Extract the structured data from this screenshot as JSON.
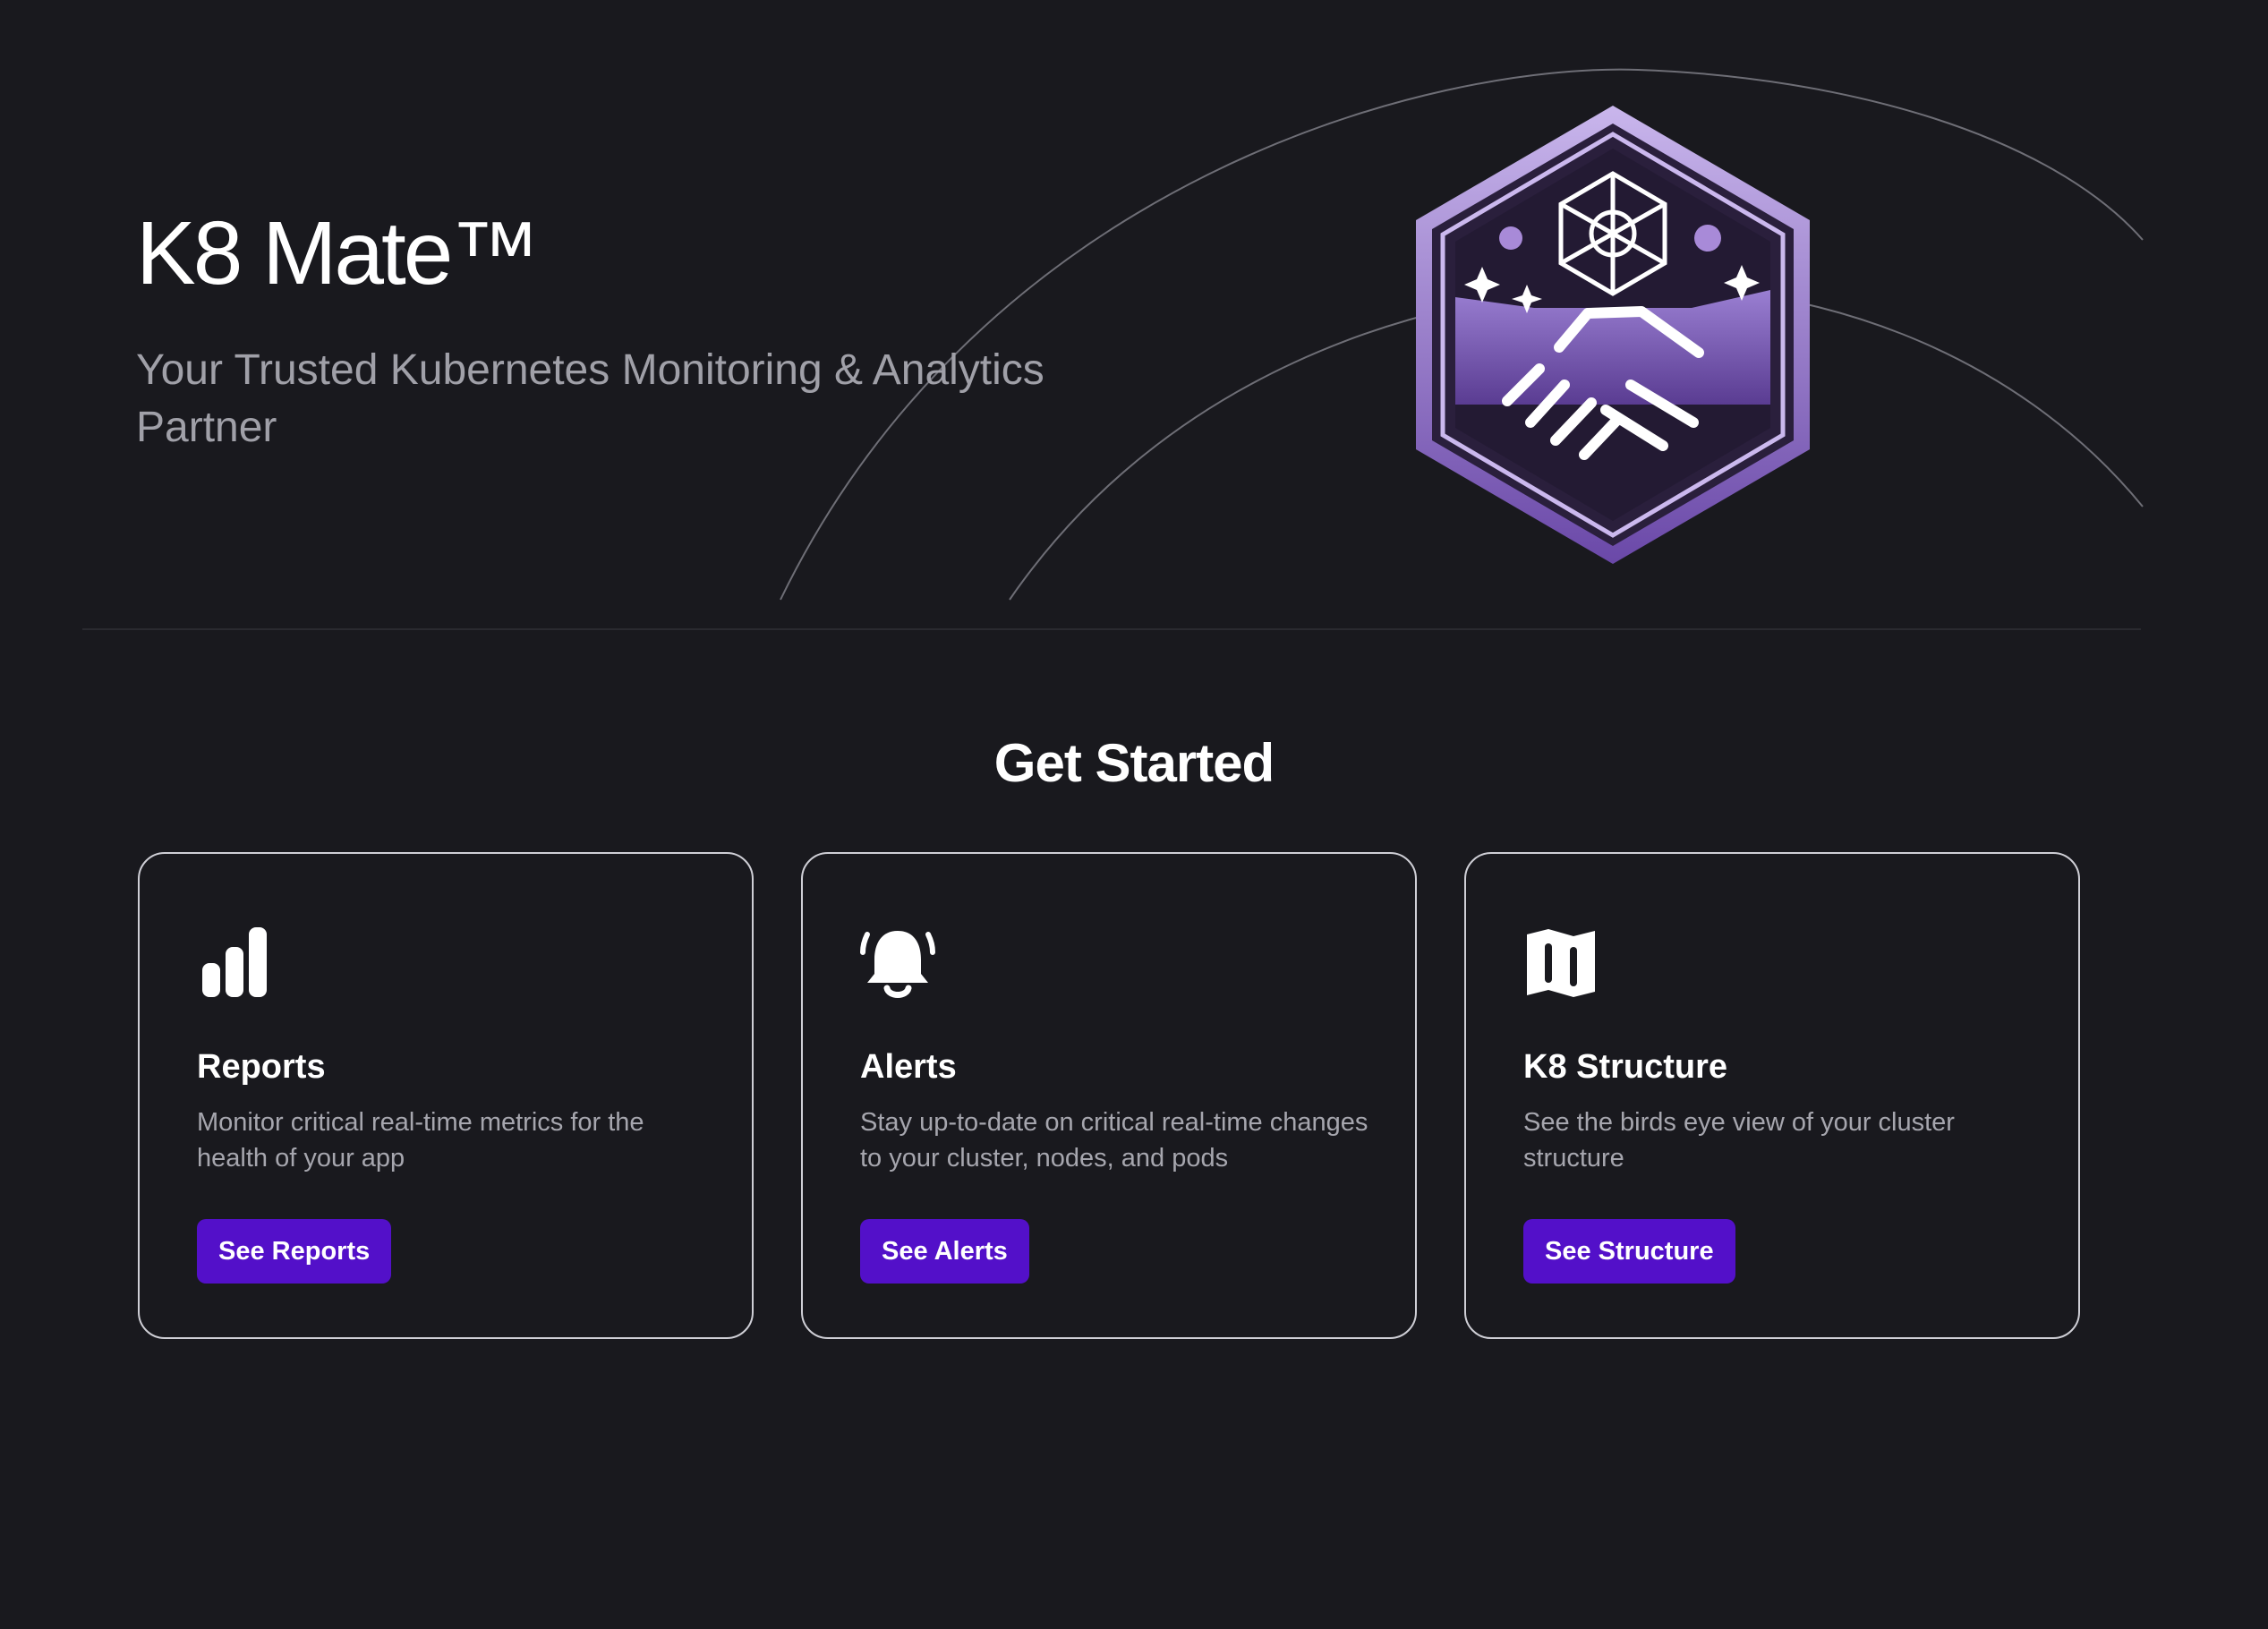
{
  "hero": {
    "title": "K8 Mate™",
    "subtitle": "Your Trusted Kubernetes Monitoring & Analytics Partner",
    "logo_icon": "handshake-hexagon-badge-icon"
  },
  "get_started": {
    "heading": "Get Started",
    "cards": [
      {
        "icon": "bar-chart-icon",
        "title": "Reports",
        "description": "Monitor critical real-time metrics for the health of your app",
        "button_label": "See Reports"
      },
      {
        "icon": "bell-ringing-icon",
        "title": "Alerts",
        "description": "Stay up-to-date on critical real-time changes to your cluster, nodes, and pods",
        "button_label": "See Alerts"
      },
      {
        "icon": "map-icon",
        "title": "K8 Structure",
        "description": "See the birds eye view of your cluster structure",
        "button_label": "See Structure"
      }
    ]
  },
  "colors": {
    "background": "#19191e",
    "accent_button": "#5310c9",
    "logo_purple": "#7a5cb6",
    "card_border": "#cfcfd6",
    "muted_text": "#a6a6ae"
  }
}
